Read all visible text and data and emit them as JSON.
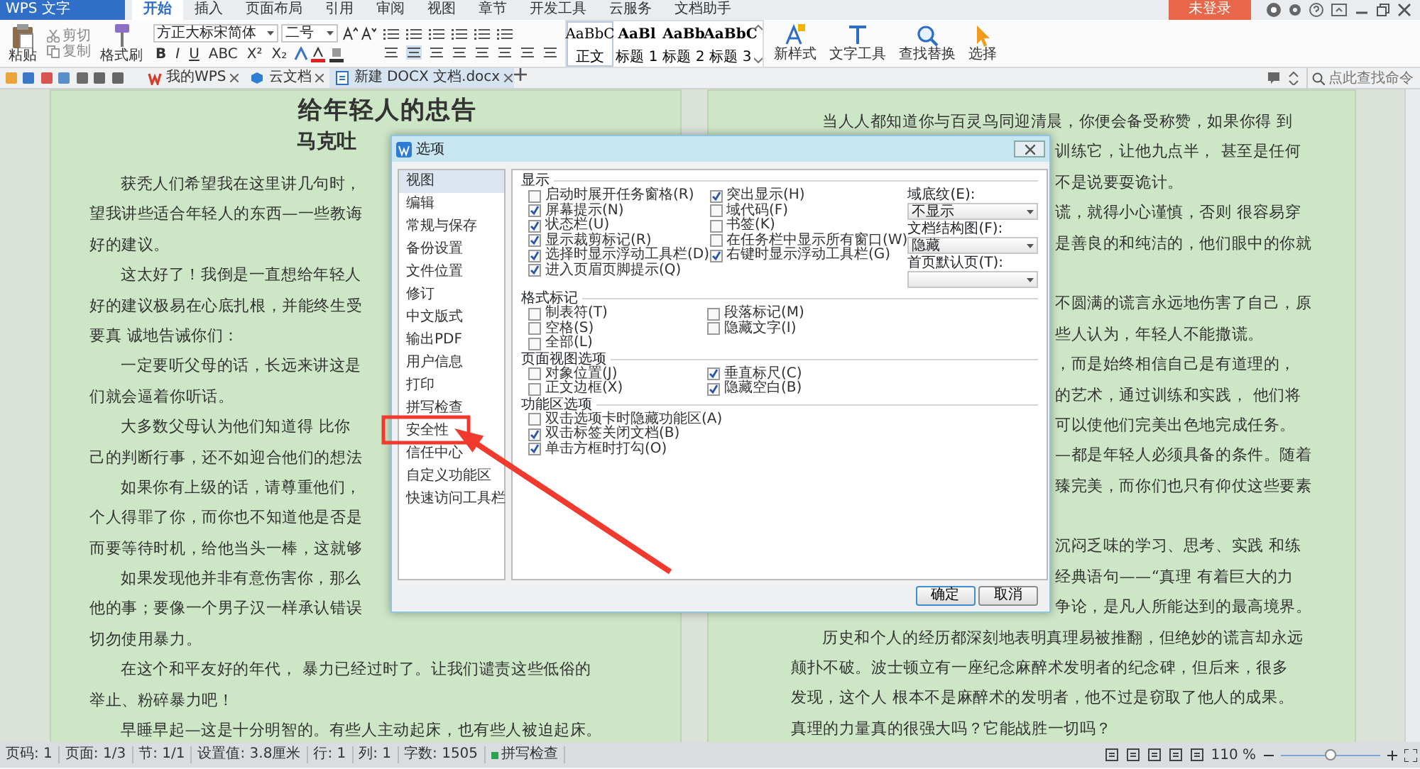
{
  "app": {
    "menu_button": "WPS 文字",
    "login": "未登录",
    "tabs": [
      {
        "label": "开始",
        "selected": true
      },
      {
        "label": "插入",
        "selected": false
      },
      {
        "label": "页面布局",
        "selected": false
      },
      {
        "label": "引用",
        "selected": false
      },
      {
        "label": "审阅",
        "selected": false
      },
      {
        "label": "视图",
        "selected": false
      },
      {
        "label": "章节",
        "selected": false
      },
      {
        "label": "开发工具",
        "selected": false
      },
      {
        "label": "云服务",
        "selected": false
      },
      {
        "label": "文档助手",
        "selected": false
      }
    ]
  },
  "ribbon": {
    "paste": "粘贴",
    "cut": "剪切",
    "copy": "复制",
    "format_painter": "格式刷",
    "font": {
      "name": "方正大标宋简体",
      "size": "二号",
      "buttons": [
        "B",
        "I",
        "U",
        "ABC",
        "X²",
        "X₂"
      ]
    },
    "styles": [
      {
        "preview": "AaBbC",
        "label": "正文",
        "selected": true
      },
      {
        "preview": "AaBl",
        "label": "标题 1",
        "selected": false
      },
      {
        "preview": "AaBb",
        "label": "标题 2",
        "selected": false
      },
      {
        "preview": "AaBbC",
        "label": "标题 3",
        "selected": false
      }
    ],
    "tools": [
      {
        "kind": "styles",
        "label": "新样式"
      },
      {
        "kind": "text",
        "label": "文字工具"
      },
      {
        "kind": "find",
        "label": "查找替换"
      },
      {
        "kind": "select",
        "label": "选择"
      }
    ]
  },
  "doc_tabs": [
    {
      "kind": "home",
      "label": "我的WPS",
      "selected": false
    },
    {
      "kind": "cloud",
      "label": "云文档",
      "selected": false
    },
    {
      "kind": "doc",
      "label": "新建 DOCX 文档.docx",
      "selected": true
    }
  ],
  "command_search": {
    "placeholder": "点此查找命令"
  },
  "document": {
    "left_page": {
      "title": "给年轻人的忠告",
      "subtitle": "马克吐",
      "lines": [
        {
          "text": "获秃人们希望我在这里讲几句时，",
          "indent": true
        },
        {
          "text": "望我讲些适合年轻人的东西—一些教诲",
          "indent": false
        },
        {
          "text": "好的建议。",
          "indent": false
        },
        {
          "text": "这太好了！我倒是一直想给年轻人",
          "indent": true
        },
        {
          "text": "好的建议极易在心底扎根，并能终生受",
          "indent": false
        },
        {
          "text": "要真 诚地告诫你们：",
          "indent": false
        },
        {
          "text": "一定要听父母的话，长远来讲这是",
          "indent": true
        },
        {
          "text": "们就会逼着你听话。",
          "indent": false
        },
        {
          "text": "大多数父母认为他们知道得 比你",
          "indent": true
        },
        {
          "text": "己的判断行事，还不如迎合他们的想法",
          "indent": false
        },
        {
          "text": "如果你有上级的话，请尊重他们，",
          "indent": true
        },
        {
          "text": "个人得罪了你，而你也不知道他是否是",
          "indent": false
        },
        {
          "text": "而要等待时机，给他当头一棒，这就够",
          "indent": false
        },
        {
          "text": "如果发现他并非有意伤害你，那么",
          "indent": true
        },
        {
          "text": "他的事；要像一个男子汉一样承认错误",
          "indent": false
        },
        {
          "text": "切勿使用暴力。",
          "indent": false
        },
        {
          "text": "在这个和平友好的年代， 暴力已经过时了。让我们谴责这些低俗的",
          "indent": true
        },
        {
          "text": "举止、粉碎暴力吧！",
          "indent": false
        },
        {
          "text": "早睡早起—这是十分明智的。有些人主动起床，也有些人被迫起床。",
          "indent": true
        }
      ]
    },
    "right_page": {
      "blocks": [
        {
          "clipped": false,
          "lines": [
            {
              "text": "当人人都知道你与百灵鸟同迎清晨，你便会备受称赞，如果你得 到",
              "indent": true
            }
          ]
        },
        {
          "clipped": true,
          "lines": [
            {
              "text": "训练它，让他九点半， 甚至是任何",
              "indent": false
            },
            {
              "text": "不是说要耍诡计。",
              "indent": false
            },
            {
              "text": "谎，就得小心谨慎，否则 很容易穿",
              "indent": false
            },
            {
              "text": "是善良的和纯洁的，他们眼中的你就",
              "indent": false
            }
          ]
        },
        {
          "clipped": true,
          "lines": [
            {
              "text": "不圆满的谎言永远地伤害了自己，原",
              "indent": false
            },
            {
              "text": "些人认为，年轻人不能撒谎。",
              "indent": false
            },
            {
              "text": "，而是始终相信自己是有道理的，",
              "indent": false
            },
            {
              "text": "的艺术，通过训练和实践， 他们将",
              "indent": false
            },
            {
              "text": "可以使他们完美出色地完成任务。",
              "indent": false
            },
            {
              "text": "—都是年轻人必须具备的条件。随着",
              "indent": false
            },
            {
              "text": "臻完美，而你们也只有仰仗这些要素",
              "indent": false
            }
          ]
        },
        {
          "clipped": true,
          "lines": [
            {
              "text": "沉闷乏味的学习、思考、实践 和练",
              "indent": false
            },
            {
              "text": "经典语句——“真理 有着巨大的力",
              "indent": false
            },
            {
              "text": "争论，是凡人所能达到的最高境界。",
              "indent": false
            }
          ]
        },
        {
          "clipped": false,
          "lines": [
            {
              "text": "历史和个人的经历都深刻地表明真理易被推翻，但绝妙的谎言却永远",
              "indent": true
            },
            {
              "text": "颠扑不破。波士顿立有一座纪念麻醉术发明者的纪念碑，但后来，很多",
              "indent": false
            },
            {
              "text": "发现，这个人 根本不是麻醉术的发明者，他不过是窃取了他人的成果。",
              "indent": false
            },
            {
              "text": "真理的力量真的很强大吗？它能战胜一切吗？",
              "indent": false
            }
          ]
        }
      ]
    }
  },
  "dialog": {
    "title": "选项",
    "nav": [
      {
        "label": "视图",
        "selected": true
      },
      {
        "label": "编辑",
        "selected": false
      },
      {
        "label": "常规与保存",
        "selected": false
      },
      {
        "label": "备份设置",
        "selected": false
      },
      {
        "label": "文件位置",
        "selected": false
      },
      {
        "label": "修订",
        "selected": false
      },
      {
        "label": "中文版式",
        "selected": false
      },
      {
        "label": "输出PDF",
        "selected": false
      },
      {
        "label": "用户信息",
        "selected": false
      },
      {
        "label": "打印",
        "selected": false
      },
      {
        "label": "拼写检查",
        "selected": false
      },
      {
        "label": "安全性",
        "selected": false
      },
      {
        "label": "信任中心",
        "selected": false
      },
      {
        "label": "自定义功能区",
        "selected": false
      },
      {
        "label": "快速访问工具栏",
        "selected": false
      }
    ],
    "sections": [
      {
        "heading": "显示",
        "columns": [
          [
            {
              "label": "启动时展开任务窗格(R)",
              "checked": false
            },
            {
              "label": "屏幕提示(N)",
              "checked": true
            },
            {
              "label": "状态栏(U)",
              "checked": true
            },
            {
              "label": "显示裁剪标记(R)",
              "checked": true
            },
            {
              "label": "选择时显示浮动工具栏(D)",
              "checked": true
            },
            {
              "label": "进入页眉页脚提示(Q)",
              "checked": true
            }
          ],
          [
            {
              "label": "突出显示(H)",
              "checked": true
            },
            {
              "label": "域代码(F)",
              "checked": false
            },
            {
              "label": "书签(K)",
              "checked": false
            },
            {
              "label": "在任务栏中显示所有窗口(W)",
              "checked": false
            },
            {
              "label": "右键时显示浮动工具栏(G)",
              "checked": true
            }
          ]
        ],
        "dropdowns": [
          {
            "label": "域底纹(E):",
            "value": "不显示"
          },
          {
            "label": "文档结构图(F):",
            "value": "隐藏"
          },
          {
            "label": "首页默认页(T):"
          }
        ]
      },
      {
        "heading": "格式标记",
        "columns": [
          [
            {
              "label": "制表符(T)",
              "checked": false
            },
            {
              "label": "空格(S)",
              "checked": false
            },
            {
              "label": "全部(L)",
              "checked": false
            }
          ],
          [
            {
              "label": "段落标记(M)",
              "checked": false
            },
            {
              "label": "隐藏文字(I)",
              "checked": false
            }
          ]
        ]
      },
      {
        "heading": "页面视图选项",
        "columns": [
          [
            {
              "label": "对象位置(J)",
              "checked": false
            },
            {
              "label": "正文边框(X)",
              "checked": false
            }
          ],
          [
            {
              "label": "垂直标尺(C)",
              "checked": true
            },
            {
              "label": "隐藏空白(B)",
              "checked": true
            }
          ]
        ]
      },
      {
        "heading": "功能区选项",
        "columns": [
          [
            {
              "label": "双击选项卡时隐藏功能区(A)",
              "checked": false
            },
            {
              "label": "双击标签关闭文档(B)",
              "checked": true
            },
            {
              "label": "单击方框时打勾(O)",
              "checked": true
            }
          ]
        ]
      }
    ],
    "buttons": [
      {
        "label": "确定",
        "default": true
      },
      {
        "label": "取消",
        "default": false
      }
    ]
  },
  "status_bar": {
    "items": [
      "页码: 1",
      "页面: 1/3",
      "节: 1/1",
      "设置值: 3.8厘米",
      "行: 1",
      "列: 1",
      "字数: 1505"
    ],
    "spell_check": "拼写检查",
    "zoom": {
      "reading": "110 %",
      "level": 0.5
    }
  }
}
